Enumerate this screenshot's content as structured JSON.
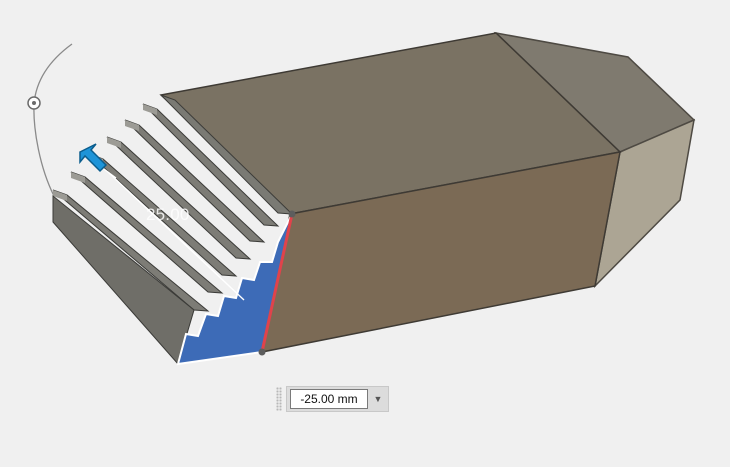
{
  "dimension": {
    "label": "25.00",
    "input_value": "-25.00 mm",
    "dropdown_icon": "chevron-down-icon"
  },
  "colors": {
    "body_top": "#7a7263",
    "body_front": "#7b6a55",
    "stairs": "#7c7b76",
    "selected_face": "#3d6bb7",
    "selected_edge": "#e0434b",
    "arrow": "#1e94d8"
  }
}
